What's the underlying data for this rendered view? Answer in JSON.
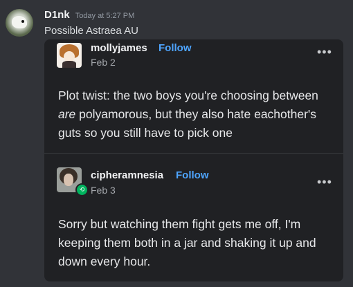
{
  "message": {
    "author": "D1nk",
    "timestamp": "Today at 5:27 PM",
    "text": "Possible Astraea AU"
  },
  "embed": {
    "posts": [
      {
        "author": "mollyjames",
        "follow_label": "Follow",
        "date": "Feb 2",
        "more_label": "•••",
        "body_before": "Plot twist: the two boys you're choosing between ",
        "body_em": "are",
        "body_after": " polyamorous, but they also hate eachother's guts so you still have to pick one"
      },
      {
        "author": "cipheramnesia",
        "follow_label": "Follow",
        "date": "Feb 3",
        "more_label": "•••",
        "reblog_icon": "⟲",
        "body": "Sorry but watching them fight gets me off, I'm keeping them both in a jar and shaking it up and down every hour."
      }
    ]
  },
  "colors": {
    "background": "#313338",
    "card": "#202124",
    "follow": "#4ea5ff",
    "reblog": "#00b35e"
  }
}
